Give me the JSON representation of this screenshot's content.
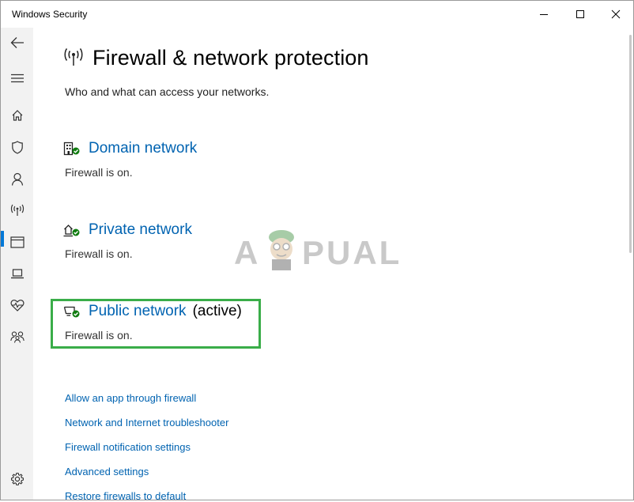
{
  "window": {
    "title": "Windows Security"
  },
  "sidebar": {
    "items": [
      {
        "name": "back",
        "icon": "back-arrow-icon"
      },
      {
        "name": "menu",
        "icon": "hamburger-icon"
      },
      {
        "name": "home",
        "icon": "home-icon"
      },
      {
        "name": "virus-protection",
        "icon": "shield-icon"
      },
      {
        "name": "account-protection",
        "icon": "person-icon"
      },
      {
        "name": "firewall",
        "icon": "antenna-icon",
        "active": true
      },
      {
        "name": "app-browser-control",
        "icon": "browser-window-icon"
      },
      {
        "name": "device-security",
        "icon": "laptop-icon"
      },
      {
        "name": "device-performance",
        "icon": "heart-pulse-icon"
      },
      {
        "name": "family-options",
        "icon": "family-icon"
      },
      {
        "name": "settings",
        "icon": "gear-icon"
      }
    ],
    "active_color": "#0078d7"
  },
  "main": {
    "title": "Firewall & network protection",
    "subtitle": "Who and what can access your networks.",
    "networks": [
      {
        "name": "Domain network",
        "status": "Firewall is on.",
        "icon": "domain-network-icon",
        "active_label": ""
      },
      {
        "name": "Private network",
        "status": "Firewall is on.",
        "icon": "private-network-icon",
        "active_label": ""
      },
      {
        "name": "Public network",
        "status": "Firewall is on.",
        "icon": "public-network-icon",
        "active_label": "(active)"
      }
    ],
    "links": [
      "Allow an app through firewall",
      "Network and Internet troubleshooter",
      "Firewall notification settings",
      "Advanced settings",
      "Restore firewalls to default"
    ],
    "link_color": "#0063b1",
    "status_ok_color": "#107c10",
    "highlight_color": "#3aad49"
  },
  "watermark": {
    "text_left": "A",
    "text_right": "PUALS"
  }
}
